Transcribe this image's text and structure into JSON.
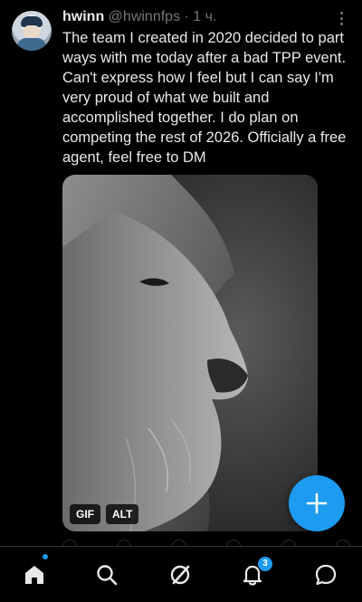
{
  "tweet": {
    "author_name": "hwinn",
    "author_handle": "@hwinnfps",
    "separator": "·",
    "time": "1 ч.",
    "text": "The team I created in 2020 decided to part ways with me today after a bad TPP event. Can't express how I feel but I can say I'm very proud of what we built and accomplished together. I do plan on competing the rest of 2026. Officially a free agent, feel free to DM",
    "media": {
      "badges": {
        "gif": "GIF",
        "alt": "ALT"
      }
    }
  },
  "fab": {
    "icon": "plus-icon",
    "color": "#1d9bf0"
  },
  "nav": {
    "items": [
      {
        "name": "home",
        "icon": "home-icon",
        "active": true
      },
      {
        "name": "search",
        "icon": "search-icon"
      },
      {
        "name": "grok",
        "icon": "grok-icon"
      },
      {
        "name": "notifications",
        "icon": "bell-icon",
        "badge": "3"
      },
      {
        "name": "messages",
        "icon": "message-icon"
      }
    ]
  },
  "colors": {
    "background": "#000000",
    "text": "#e7e9ea",
    "muted": "#71767b",
    "accent": "#1d9bf0"
  }
}
